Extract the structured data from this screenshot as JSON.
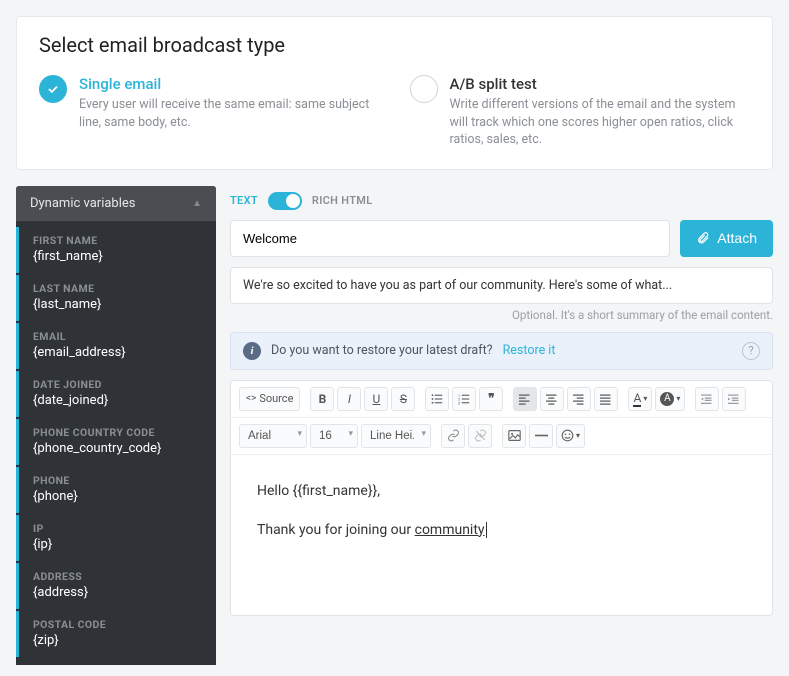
{
  "header": {
    "title": "Select email broadcast type",
    "options": [
      {
        "title": "Single email",
        "desc": "Every user will receive the same email: same subject line, same body, etc.",
        "selected": true
      },
      {
        "title": "A/B split test",
        "desc": "Write different versions of the email and the system will track which one scores higher open ratios, click ratios, sales, etc.",
        "selected": false
      }
    ]
  },
  "sidebar": {
    "title": "Dynamic variables",
    "items": [
      {
        "label": "FIRST NAME",
        "token": "{first_name}"
      },
      {
        "label": "LAST NAME",
        "token": "{last_name}"
      },
      {
        "label": "EMAIL",
        "token": "{email_address}"
      },
      {
        "label": "DATE JOINED",
        "token": "{date_joined}"
      },
      {
        "label": "PHONE COUNTRY CODE",
        "token": "{phone_country_code}"
      },
      {
        "label": "PHONE",
        "token": "{phone}"
      },
      {
        "label": "IP",
        "token": "{ip}"
      },
      {
        "label": "ADDRESS",
        "token": "{address}"
      },
      {
        "label": "POSTAL CODE",
        "token": "{zip}"
      }
    ]
  },
  "editor": {
    "toggle": {
      "left": "TEXT",
      "right": "RICH HTML"
    },
    "subject": "Welcome",
    "attach": "Attach",
    "summary": "We're so excited to have you as part of our community. Here's some of what...",
    "summary_hint": "Optional. It's a short summary of the email content.",
    "restore": {
      "text": "Do you want to restore your latest draft?",
      "link": "Restore it"
    },
    "toolbar": {
      "source": "Source",
      "font": "Arial",
      "size": "16",
      "lineheight": "Line Hei..."
    },
    "body": {
      "line1a": "Hello {{first_name}},",
      "line2a": "Thank you for joining our ",
      "line2b": "community"
    }
  }
}
